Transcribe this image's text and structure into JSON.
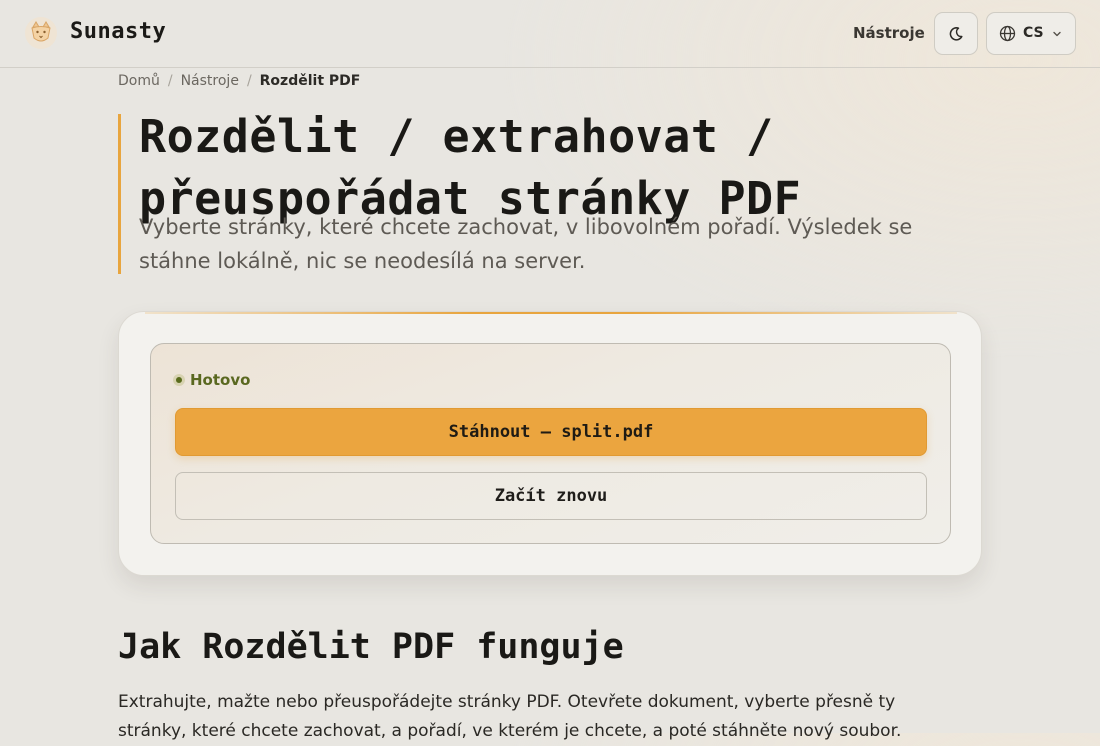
{
  "header": {
    "brand": "Sunasty",
    "nav_tools": "Nástroje",
    "language": "CS"
  },
  "breadcrumb": {
    "home": "Domů",
    "tools": "Nástroje",
    "current": "Rozdělit PDF"
  },
  "page": {
    "title": "Rozdělit / extrahovat / přeuspořádat stránky PDF",
    "subtitle": "Vyberte stránky, které chcete zachovat, v libovolném pořadí. Výsledek se stáhne lokálně, nic se neodesílá na server."
  },
  "result": {
    "status": "Hotovo",
    "download_label": "Stáhnout — split.pdf",
    "restart_label": "Začít znovu"
  },
  "how": {
    "title": "Jak Rozdělit PDF funguje",
    "text": "Extrahujte, mažte nebo přeuspořádejte stránky PDF. Otevřete dokument, vyberte přesně ty stránky, které chcete zachovat, a pořadí, ve kterém je chcete, a poté stáhněte nový soubor."
  },
  "icons": {
    "logo": "fox-logo-icon",
    "theme": "moon-icon",
    "language": "globe-icon",
    "dropdown": "chevron-down-icon"
  },
  "colors": {
    "accent": "#eba53f",
    "status_ok": "#5a6820",
    "background": "#e8e6e1"
  }
}
